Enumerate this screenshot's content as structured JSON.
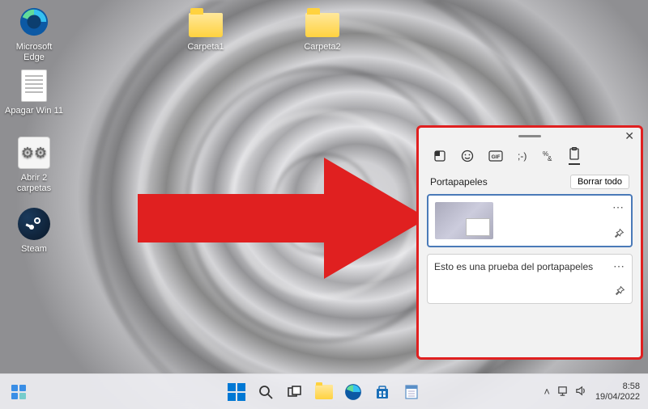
{
  "desktop": {
    "icons": [
      {
        "name": "edge",
        "label": "Microsoft Edge"
      },
      {
        "name": "shutdown-script",
        "label": "Apagar Win 11"
      },
      {
        "name": "open-folders-script",
        "label": "Abrir 2 carpetas"
      },
      {
        "name": "steam",
        "label": "Steam"
      },
      {
        "name": "folder1",
        "label": "Carpeta1"
      },
      {
        "name": "folder2",
        "label": "Carpeta2"
      }
    ]
  },
  "clipboard_panel": {
    "title": "Portapapeles",
    "clear_all": "Borrar todo",
    "tabs": [
      "recent",
      "emoji",
      "gif",
      "kaomoji",
      "symbols",
      "clipboard"
    ],
    "items": [
      {
        "type": "image",
        "description": "screenshot-thumbnail"
      },
      {
        "type": "text",
        "text": "Esto es una prueba del portapapeles"
      }
    ]
  },
  "taskbar": {
    "apps": [
      "start",
      "search",
      "task-view",
      "file-explorer",
      "edge",
      "store",
      "notepad"
    ],
    "tray": {
      "chevron": "^",
      "network": "network",
      "volume": "volume"
    },
    "clock": {
      "time": "8:58",
      "date": "19/04/2022"
    }
  },
  "annotation": {
    "arrow_color": "#e02020"
  }
}
